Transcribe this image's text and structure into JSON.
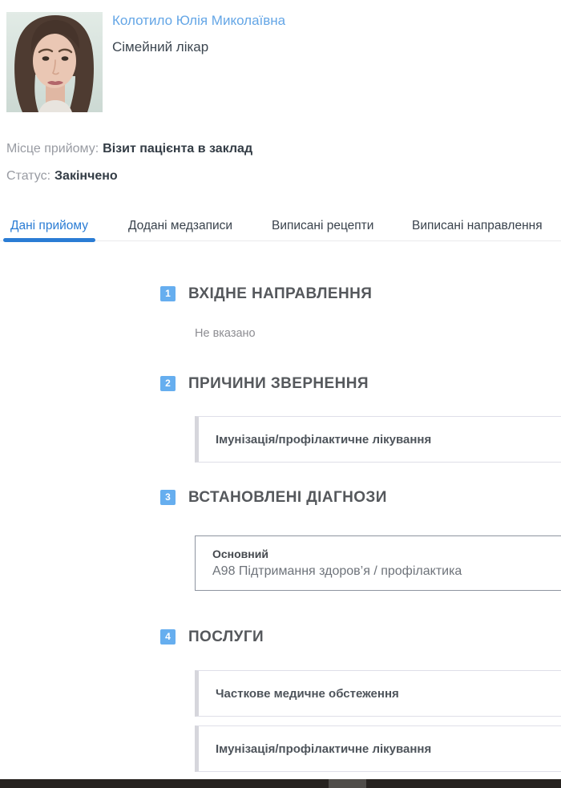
{
  "header": {
    "doctor_name": "Колотило Юлія Миколаївна",
    "doctor_role": "Сімейний лікар",
    "place_label": "Місце прийому:",
    "place_value": "Візит пацієнта в заклад",
    "status_label": "Статус:",
    "status_value": "Закінчено"
  },
  "tabs": [
    {
      "label": "Дані прийому",
      "active": true
    },
    {
      "label": "Додані медзаписи",
      "active": false
    },
    {
      "label": "Виписані рецепти",
      "active": false
    },
    {
      "label": "Виписані направлення",
      "active": false
    }
  ],
  "sections": {
    "referral": {
      "num": "1",
      "title": "ВХІДНЕ НАПРАВЛЕННЯ",
      "empty_text": "Не вказано"
    },
    "reasons": {
      "num": "2",
      "title": "ПРИЧИНИ ЗВЕРНЕННЯ",
      "items": [
        "Імунізація/профілактичне лікування"
      ]
    },
    "diagnoses": {
      "num": "3",
      "title": "ВСТАНОВЛЕНІ ДІАГНОЗИ",
      "diagnosis": {
        "type_label": "Основний",
        "text": "A98 Підтримання здоров’я / профілактика"
      }
    },
    "services": {
      "num": "4",
      "title": "ПОСЛУГИ",
      "items": [
        "Часткове медичне обстеження",
        "Імунізація/профілактичне лікування"
      ]
    }
  },
  "colors": {
    "accent_blue": "#2a7cd4",
    "badge_blue": "#66aeef",
    "link_blue": "#64a6e6",
    "card_border": "#dfdfe8",
    "diagnosis_border": "#8e95a0",
    "bottom_bar": "#272320",
    "bottom_thumb": "#504d4a"
  }
}
